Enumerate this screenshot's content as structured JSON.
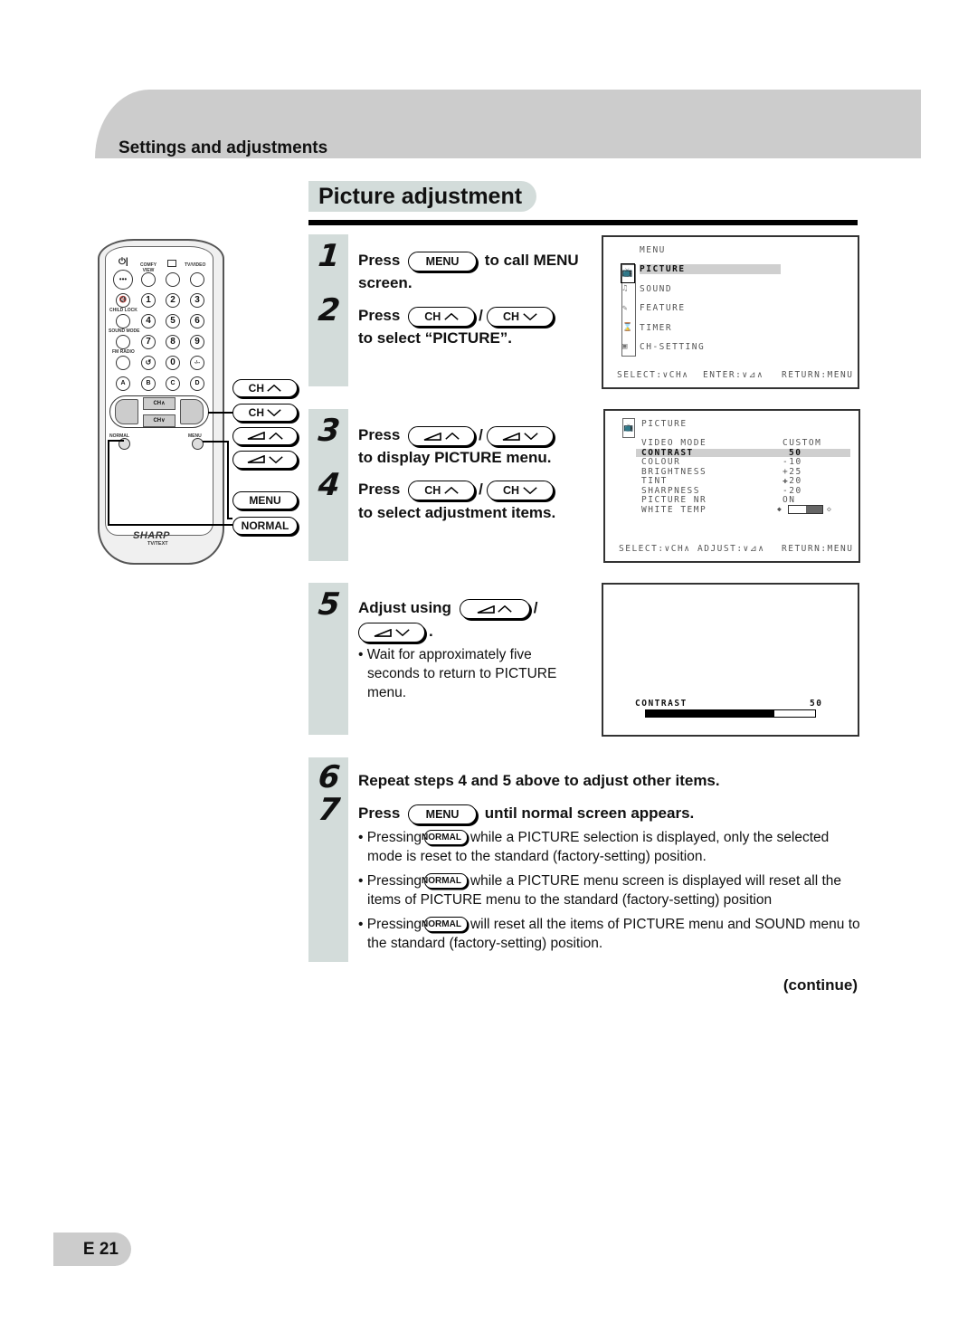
{
  "header": {
    "section_title": "Settings and adjustments",
    "page_title": "Picture adjustment"
  },
  "keys": {
    "menu": "MENU",
    "ch": "CH",
    "normal": "NORMAL"
  },
  "steps": {
    "s1": {
      "number": "1",
      "before": "Press",
      "after": "to call MENU",
      "line2": "screen."
    },
    "s2": {
      "number": "2",
      "before": "Press",
      "sep": "/",
      "line2": "to select “PICTURE”."
    },
    "s3": {
      "number": "3",
      "before": "Press",
      "sep": "/",
      "line2": "to display PICTURE menu."
    },
    "s4": {
      "number": "4",
      "before": "Press",
      "sep": "/",
      "line2": "to select adjustment items."
    },
    "s5": {
      "number": "5",
      "before": "Adjust using",
      "sep": "/",
      "end": ".",
      "note": "• Wait for approximately five seconds to return to PICTURE menu."
    },
    "s6": {
      "number": "6",
      "text": "Repeat steps 4 and 5 above to adjust other items."
    },
    "s7": {
      "number": "7",
      "before": "Press",
      "after": "until normal screen appears.",
      "notes": [
        {
          "before": "• Pressing",
          "after": "while a PICTURE selection is displayed, only the selected mode is reset to the standard (factory-setting) position."
        },
        {
          "before": "• Pressing",
          "after": "while a PICTURE menu screen is displayed will reset all the items of PICTURE menu to the standard (factory-setting) position"
        },
        {
          "before": "• Pressing",
          "after": "will reset all the items of PICTURE menu and SOUND menu to the standard (factory-setting) position."
        }
      ]
    }
  },
  "osd_menu": {
    "title": "MENU",
    "items": [
      "PICTURE",
      "SOUND",
      "FEATURE",
      "TIMER",
      "CH-SETTING"
    ],
    "selected": "PICTURE",
    "footer": {
      "select": "SELECT:∨CH∧",
      "enter": "ENTER:∨⊿∧",
      "return": "RETURN:MENU"
    }
  },
  "osd_picture": {
    "title": "PICTURE",
    "rows": [
      {
        "label": "VIDEO MODE",
        "value": "CUSTOM"
      },
      {
        "label": "CONTRAST",
        "value": "50",
        "selected": true
      },
      {
        "label": "COLOUR",
        "value": "-10"
      },
      {
        "label": "BRIGHTNESS",
        "value": "+25"
      },
      {
        "label": "TINT",
        "value": "✚20"
      },
      {
        "label": "SHARPNESS",
        "value": "-20"
      },
      {
        "label": "PICTURE NR",
        "value": "ON"
      },
      {
        "label": "WHITE TEMP",
        "value": ""
      }
    ],
    "white_temp_level": 0.5,
    "footer": {
      "select": "SELECT:∨CH∧",
      "adjust": "ADJUST:∨⊿∧",
      "return": "RETURN:MENU"
    }
  },
  "osd_contrast": {
    "label": "CONTRAST",
    "value": "50",
    "bar_fill": 0.76
  },
  "remote": {
    "brand": "SHARP",
    "model": "TV/TEXT",
    "labels": {
      "comfy_view": "COMFY VIEW",
      "tv_video": "TV/VIDEO",
      "child_lock": "CHILD LOCK",
      "sound_mode": "SOUND MODE",
      "fm_radio": "FM RADIO",
      "normal": "NORMAL",
      "menu": "MENU"
    },
    "digits": [
      "1",
      "2",
      "3",
      "4",
      "5",
      "6",
      "7",
      "8",
      "9",
      "0"
    ],
    "letters": [
      "A",
      "B",
      "C",
      "D"
    ],
    "callouts": [
      "CH",
      "CH",
      "",
      "",
      "MENU",
      "NORMAL"
    ]
  },
  "footer": {
    "continue": "(continue)",
    "page_number": "E 21"
  }
}
